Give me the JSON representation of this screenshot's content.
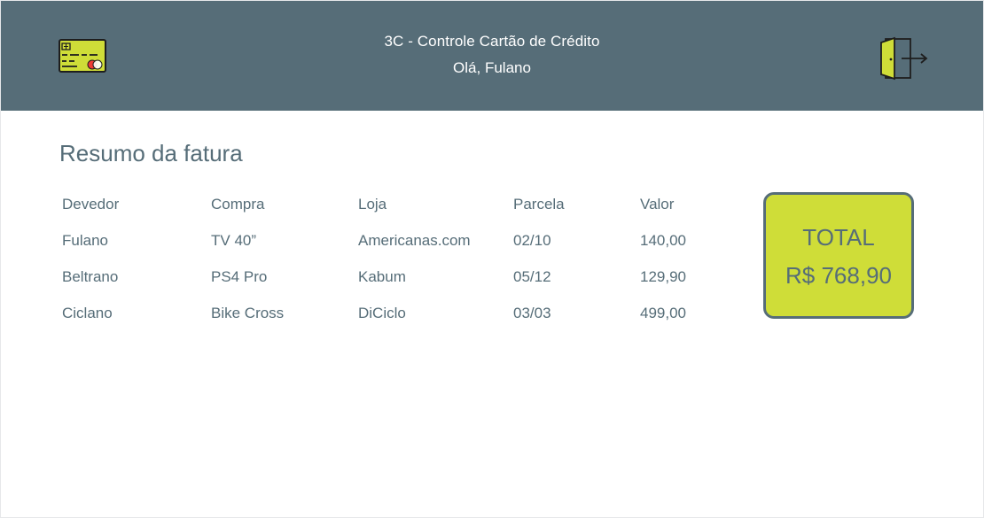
{
  "header": {
    "title": "3C - Controle Cartão de Crédito",
    "greeting": "Olá, Fulano",
    "logo_icon": "credit-card-icon",
    "logout_icon": "logout-door-icon",
    "background_color": "#566d78",
    "accent_color": "#cfdd38"
  },
  "summary": {
    "title": "Resumo da fatura",
    "columns": [
      "Devedor",
      "Compra",
      "Loja",
      "Parcela",
      "Valor"
    ],
    "rows": [
      [
        "Fulano",
        "TV 40”",
        "Americanas.com",
        "02/10",
        "140,00"
      ],
      [
        "Beltrano",
        "PS4 Pro",
        "Kabum",
        "05/12",
        "129,90"
      ],
      [
        "Ciclano",
        "Bike Cross",
        "DiCiclo",
        "03/03",
        "499,00"
      ]
    ]
  },
  "total": {
    "label": "TOTAL",
    "value": "R$ 768,90"
  }
}
